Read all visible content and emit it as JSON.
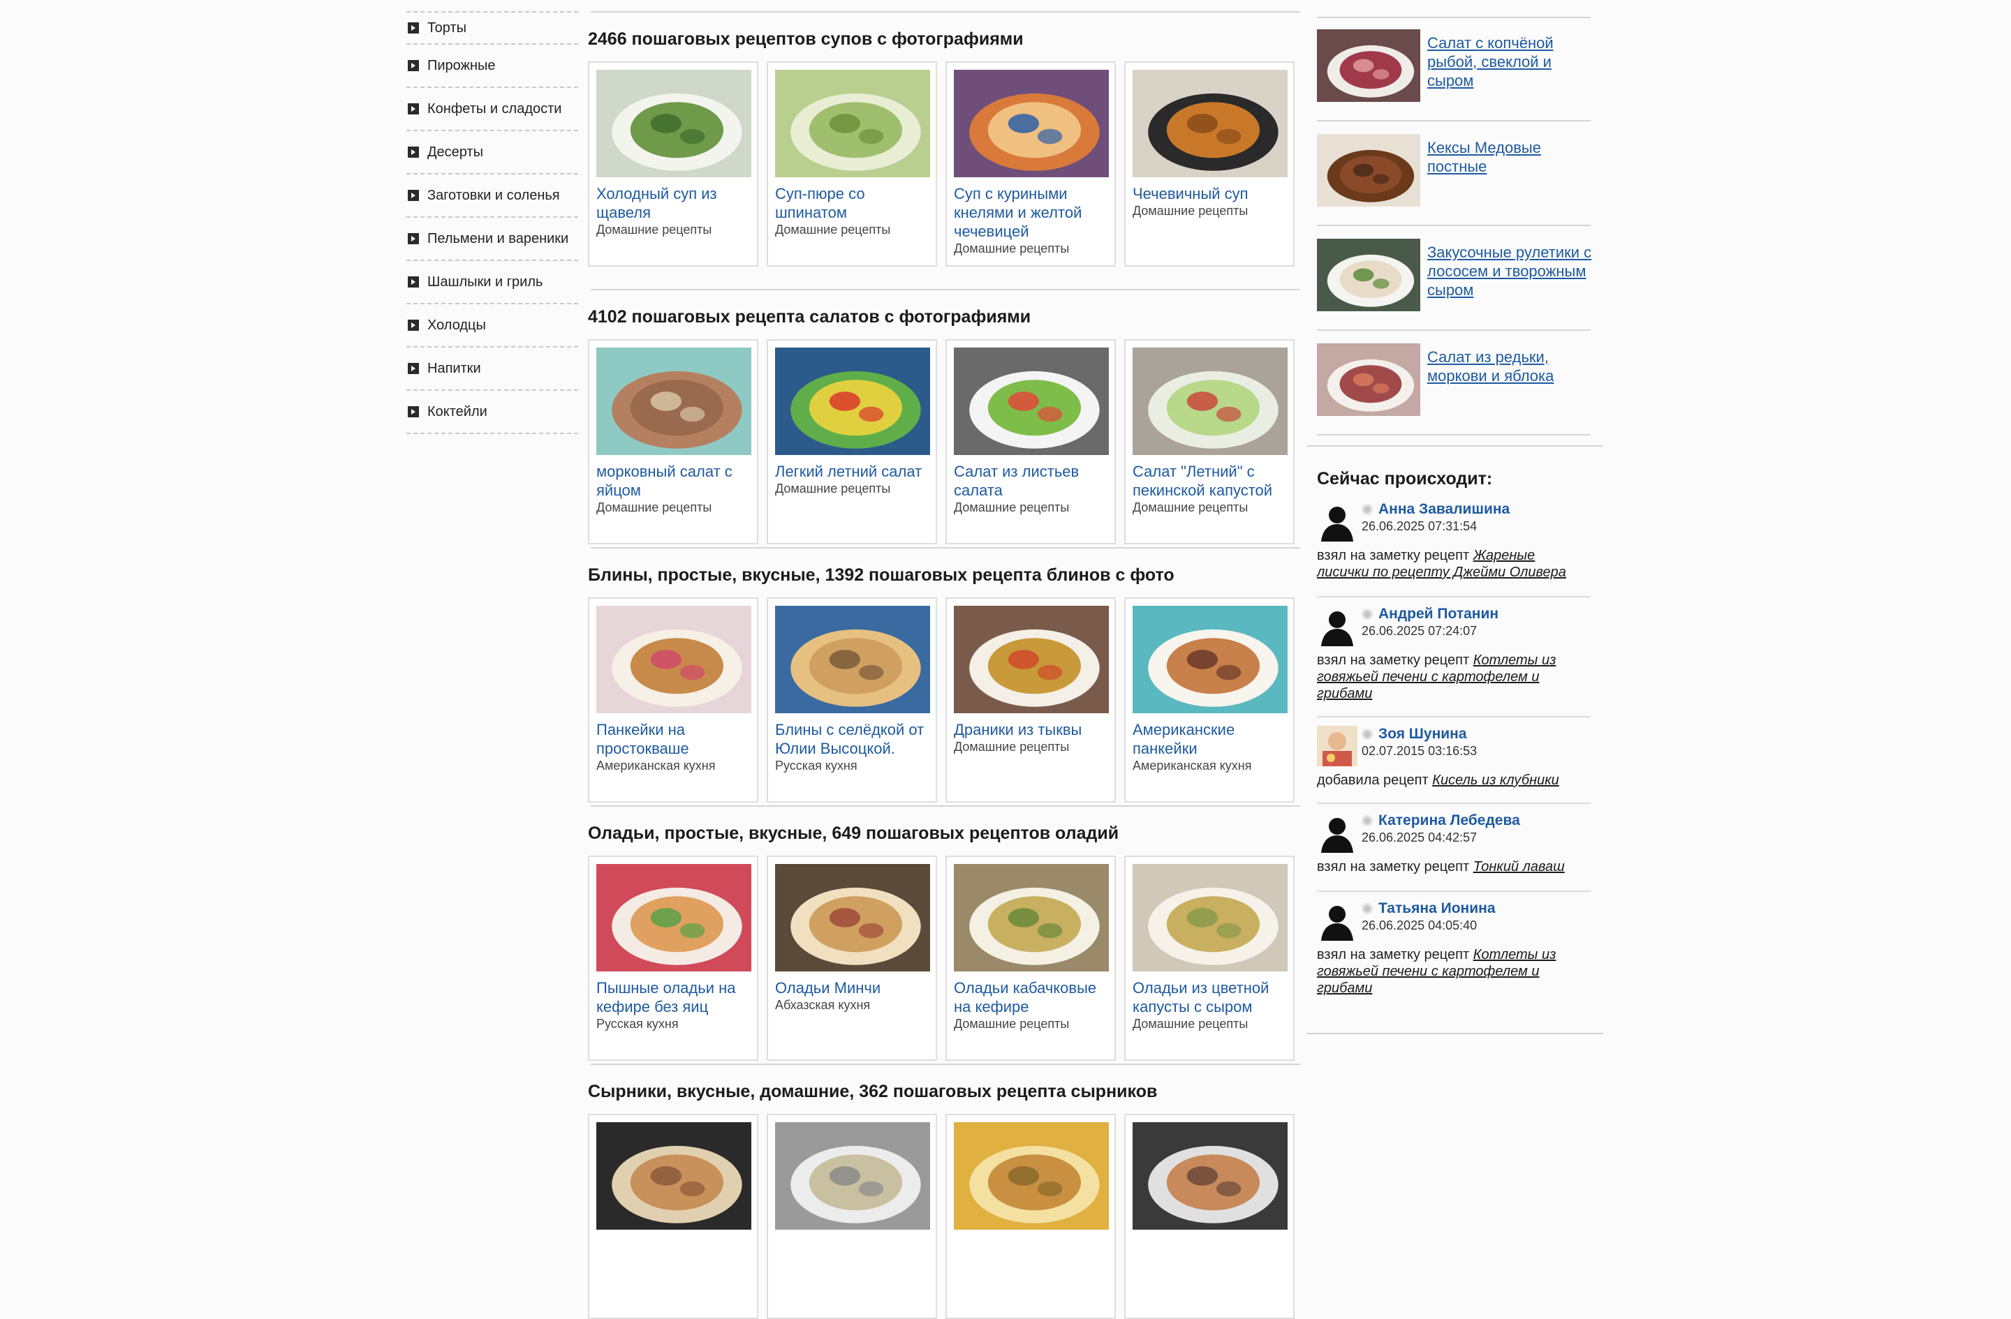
{
  "sidebar": {
    "items": [
      {
        "label": "Торты"
      },
      {
        "label": "Пирожные"
      },
      {
        "label": "Конфеты и сладости"
      },
      {
        "label": "Десерты"
      },
      {
        "label": "Заготовки и соленья"
      },
      {
        "label": "Пельмени и вареники"
      },
      {
        "label": "Шашлыки и гриль"
      },
      {
        "label": "Холодцы"
      },
      {
        "label": "Напитки"
      },
      {
        "label": "Коктейли"
      }
    ]
  },
  "sections": [
    {
      "title": "2466 пошаговых рецептов супов с фотографиями",
      "cards": [
        {
          "title": "Холодный суп из щавеля",
          "category": "Домашние рецепты",
          "image": "sorrel-soup-photo"
        },
        {
          "title": "Суп-пюре со шпинатом",
          "category": "Домашние рецепты",
          "image": "spinach-soup-photo"
        },
        {
          "title": "Суп с куриными кнелями и желтой чечевицей",
          "category": "Домашние рецепты",
          "image": "chicken-soup-photo"
        },
        {
          "title": "Чечевичный суп",
          "category": "Домашние рецепты",
          "image": "lentil-soup-photo"
        }
      ]
    },
    {
      "title": "4102 пошаговых рецепта салатов с фотографиями",
      "cards": [
        {
          "title": "морковный салат с яйцом",
          "category": "Домашние рецепты",
          "image": "carrot-salad-photo"
        },
        {
          "title": "Легкий летний салат",
          "category": "Домашние рецепты",
          "image": "summer-salad-photo"
        },
        {
          "title": "Салат из листьев салата",
          "category": "Домашние рецепты",
          "image": "lettuce-salad-photo"
        },
        {
          "title": "Салат \"Летний\" с пекинской капустой",
          "category": "Домашние рецепты",
          "image": "cabbage-salad-photo"
        }
      ]
    },
    {
      "title": "Блины, простые, вкусные, 1392 пошаговых рецепта блинов с фото",
      "cards": [
        {
          "title": "Панкейки на простокваше",
          "category": "Американская кухня",
          "image": "pancakes-photo"
        },
        {
          "title": "Блины с селёдкой от Юлии Высоцкой.",
          "category": "Русская кухня",
          "image": "herring-blini-photo"
        },
        {
          "title": "Драники из тыквы",
          "category": "Домашние рецепты",
          "image": "pumpkin-draniki-photo"
        },
        {
          "title": "Американские панкейки",
          "category": "Американская кухня",
          "image": "american-pancakes-photo"
        }
      ]
    },
    {
      "title": "Оладьи, простые, вкусные, 649 пошаговых рецептов оладий",
      "cards": [
        {
          "title": "Пышные оладьи на кефире без яиц",
          "category": "Русская кухня",
          "image": "kefir-fritters-photo"
        },
        {
          "title": "Оладьи Минчи",
          "category": "Абхазская кухня",
          "image": "minchi-photo"
        },
        {
          "title": "Оладьи кабачковые на кефире",
          "category": "Домашние рецепты",
          "image": "zucchini-fritters-photo"
        },
        {
          "title": "Оладьи из цветной капусты с сыром",
          "category": "Домашние рецепты",
          "image": "cauliflower-fritters-photo"
        }
      ]
    },
    {
      "title": "Сырники, вкусные, домашние, 362 пошаговых рецепта сырников",
      "cards": [
        {
          "title": "",
          "category": "",
          "image": "syrniki-photo-1"
        },
        {
          "title": "",
          "category": "",
          "image": "syrniki-photo-2"
        },
        {
          "title": "",
          "category": "",
          "image": "syrniki-photo-3"
        },
        {
          "title": "",
          "category": "",
          "image": "syrniki-photo-4"
        }
      ]
    }
  ],
  "related": [
    {
      "title": "Салат с копчёной рыбой, свеклой и сыром",
      "image": "smoked-fish-salad-photo"
    },
    {
      "title": "Кексы Медовые постные",
      "image": "honey-cupcakes-photo"
    },
    {
      "title": "Закусочные рулетики с лососем и творожным сыром",
      "image": "salmon-rolls-photo"
    },
    {
      "title": "Салат из редьки, моркови и яблока",
      "image": "radish-salad-photo"
    }
  ],
  "activity": {
    "title": "Сейчас происходит:",
    "items": [
      {
        "name": "Анна Завалишина",
        "date": "26.06.2025 07:31:54",
        "action": "взял на заметку рецепт",
        "recipe": "Жареные лисички по рецепту Джейми Оливера",
        "avatar": "silhouette"
      },
      {
        "name": "Андрей Потанин",
        "date": "26.06.2025 07:24:07",
        "action": "взял на заметку рецепт",
        "recipe": "Котлеты из говяжьей печени с картофелем и грибами",
        "avatar": "silhouette"
      },
      {
        "name": "Зоя Шунина",
        "date": "02.07.2015 03:16:53",
        "action": "добавила рецепт",
        "recipe": "Кисель из клубники",
        "avatar": "photo"
      },
      {
        "name": "Катерина Лебедева",
        "date": "26.06.2025 04:42:57",
        "action": "взял на заметку рецепт",
        "recipe": "Тонкий лаваш",
        "avatar": "silhouette"
      },
      {
        "name": "Татьяна Ионина",
        "date": "26.06.2025 04:05:40",
        "action": "взял на заметку рецепт",
        "recipe": "Котлеты из говяжьей печени с картофелем и грибами",
        "avatar": "silhouette"
      }
    ]
  },
  "colors": {
    "link": "#1e5aa0",
    "text": "#222222",
    "background": "#fbfbfb"
  }
}
